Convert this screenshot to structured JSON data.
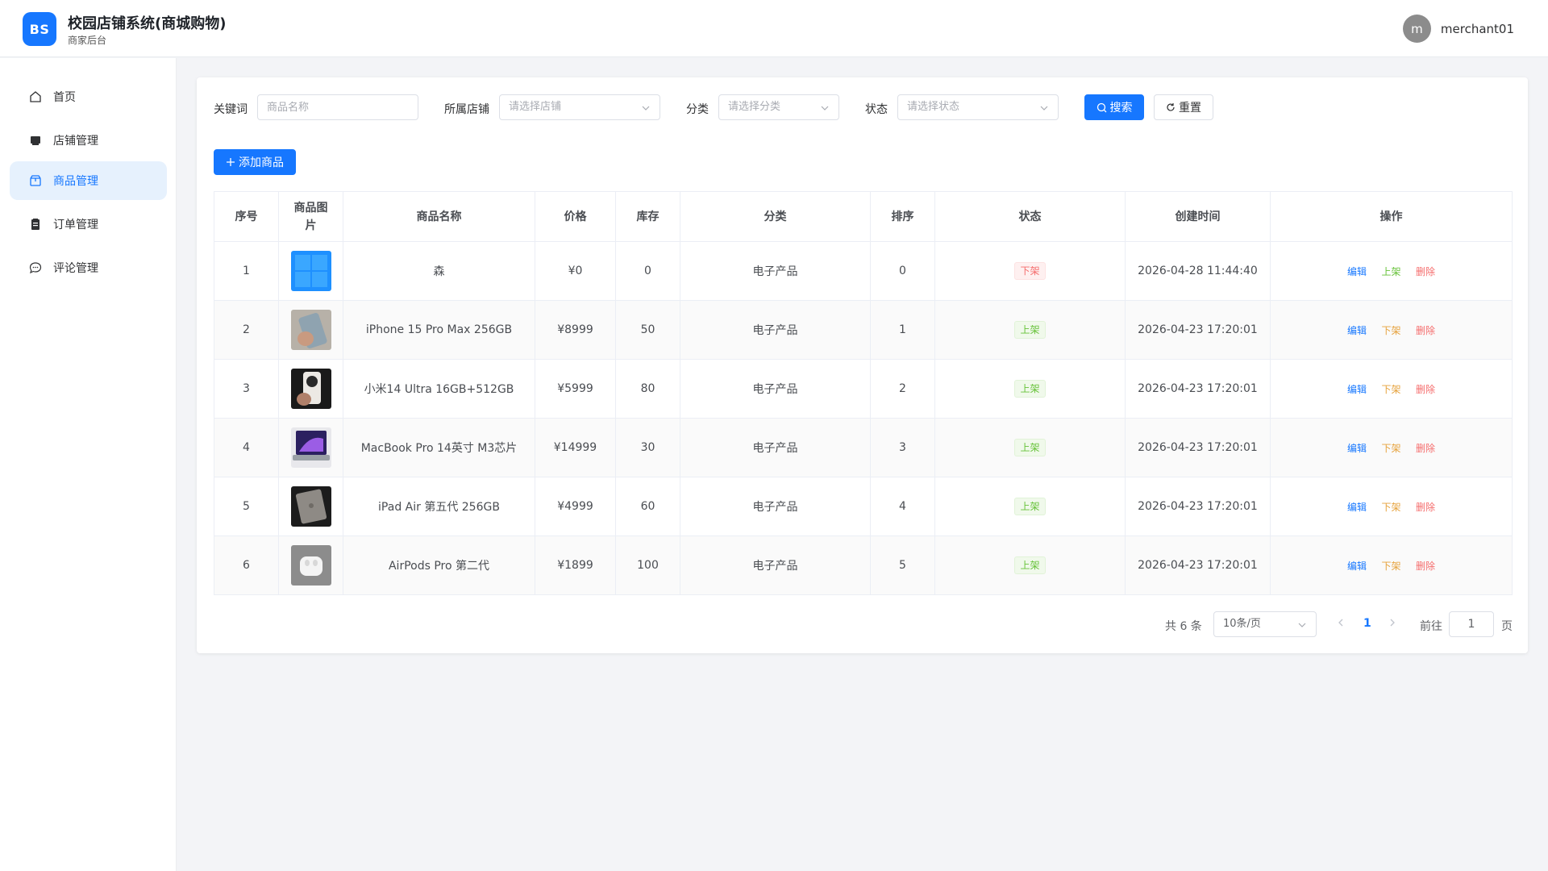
{
  "header": {
    "logo_text": "BS",
    "title": "校园店铺系统(商城购物)",
    "subtitle": "商家后台",
    "avatar_letter": "m",
    "username": "merchant01"
  },
  "sidebar": {
    "items": [
      {
        "label": "首页",
        "icon": "home-icon"
      },
      {
        "label": "店铺管理",
        "icon": "store-icon"
      },
      {
        "label": "商品管理",
        "icon": "box-icon",
        "active": true
      },
      {
        "label": "订单管理",
        "icon": "clipboard-icon"
      },
      {
        "label": "评论管理",
        "icon": "chat-icon"
      }
    ]
  },
  "filters": {
    "keyword_label": "关键词",
    "keyword_placeholder": "商品名称",
    "shop_label": "所属店铺",
    "shop_placeholder": "请选择店铺",
    "category_label": "分类",
    "category_placeholder": "请选择分类",
    "status_label": "状态",
    "status_placeholder": "请选择状态",
    "search_label": "搜索",
    "reset_label": "重置"
  },
  "add_button_label": "添加商品",
  "table": {
    "headers": [
      "序号",
      "商品图片",
      "商品名称",
      "价格",
      "库存",
      "分类",
      "排序",
      "状态",
      "创建时间",
      "操作"
    ],
    "rows": [
      {
        "index": "1",
        "name": "森",
        "price": "¥0",
        "stock": "0",
        "category": "电子产品",
        "sort": "0",
        "status": "下架",
        "created": "2026-04-28 11:44:40",
        "toggle": "上架"
      },
      {
        "index": "2",
        "name": "iPhone 15 Pro Max 256GB",
        "price": "¥8999",
        "stock": "50",
        "category": "电子产品",
        "sort": "1",
        "status": "上架",
        "created": "2026-04-23 17:20:01",
        "toggle": "下架"
      },
      {
        "index": "3",
        "name": "小米14 Ultra 16GB+512GB",
        "price": "¥5999",
        "stock": "80",
        "category": "电子产品",
        "sort": "2",
        "status": "上架",
        "created": "2026-04-23 17:20:01",
        "toggle": "下架"
      },
      {
        "index": "4",
        "name": "MacBook Pro 14英寸 M3芯片",
        "price": "¥14999",
        "stock": "30",
        "category": "电子产品",
        "sort": "3",
        "status": "上架",
        "created": "2026-04-23 17:20:01",
        "toggle": "下架"
      },
      {
        "index": "5",
        "name": "iPad Air 第五代 256GB",
        "price": "¥4999",
        "stock": "60",
        "category": "电子产品",
        "sort": "4",
        "status": "上架",
        "created": "2026-04-23 17:20:01",
        "toggle": "下架"
      },
      {
        "index": "6",
        "name": "AirPods Pro 第二代",
        "price": "¥1899",
        "stock": "100",
        "category": "电子产品",
        "sort": "5",
        "status": "上架",
        "created": "2026-04-23 17:20:01",
        "toggle": "下架"
      }
    ],
    "edit_label": "编辑",
    "delete_label": "删除"
  },
  "pagination": {
    "total": "共 6 条",
    "page_size": "10条/页",
    "current_page": "1",
    "goto_label": "前往",
    "goto_value": "1",
    "page_suffix": "页"
  },
  "colors": {
    "primary": "#1677ff",
    "success": "#67c23a",
    "warning": "#e6a23c",
    "danger": "#f56c6c"
  }
}
